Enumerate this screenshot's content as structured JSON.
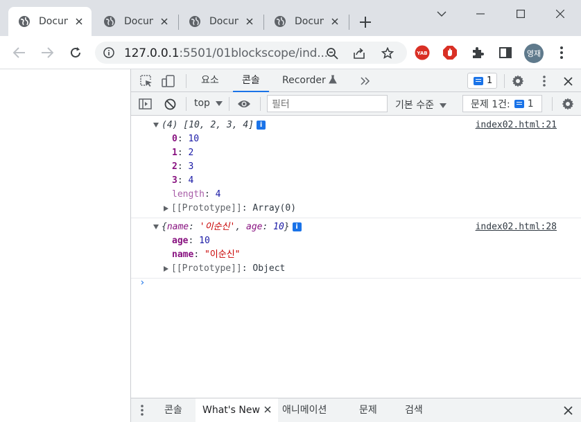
{
  "tabs": [
    {
      "title": "Document"
    },
    {
      "title": "Document"
    },
    {
      "title": "Document"
    },
    {
      "title": "Document"
    }
  ],
  "address": {
    "host": "127.0.0.1",
    "rest": ":5501/01blockscope/ind..."
  },
  "profile": {
    "initials": "영재"
  },
  "devtools": {
    "tabs": {
      "elements": "요소",
      "console": "콘솔",
      "recorder": "Recorder"
    },
    "issue_count": "1",
    "filterbar": {
      "context": "top",
      "filter_placeholder": "필터",
      "levels": "기본 수준",
      "issues_label": "문제 1건:",
      "issues_count": "1"
    },
    "entries": [
      {
        "summary_prefix": "(4) [",
        "summary_values": "10, 2, 3, 4",
        "summary_suffix": "]",
        "source": "index02.html:21",
        "props": [
          {
            "key": "0",
            "value": "10"
          },
          {
            "key": "1",
            "value": "2"
          },
          {
            "key": "2",
            "value": "3"
          },
          {
            "key": "3",
            "value": "4"
          },
          {
            "key": "length",
            "value": "4"
          }
        ],
        "proto_label": "[[Prototype]]",
        "proto_value": "Array(0)"
      },
      {
        "summary_open": "{",
        "summary_key1": "name",
        "summary_val1": "'이순신'",
        "summary_key2": "age",
        "summary_val2": "10",
        "summary_close": "}",
        "source": "index02.html:28",
        "props": [
          {
            "key": "age",
            "value": "10"
          },
          {
            "key": "name",
            "value": "\"이순신\""
          }
        ],
        "proto_label": "[[Prototype]]",
        "proto_value": "Object"
      }
    ],
    "prompt": "›",
    "drawer": {
      "console": "콘솔",
      "whats_new": "What's New",
      "animations": "애니메이션",
      "issues": "문제",
      "search": "검색"
    }
  },
  "colors": {
    "accent": "#1a73e8",
    "tabstrip": "#dee1e6",
    "panel": "#f1f3f4"
  }
}
